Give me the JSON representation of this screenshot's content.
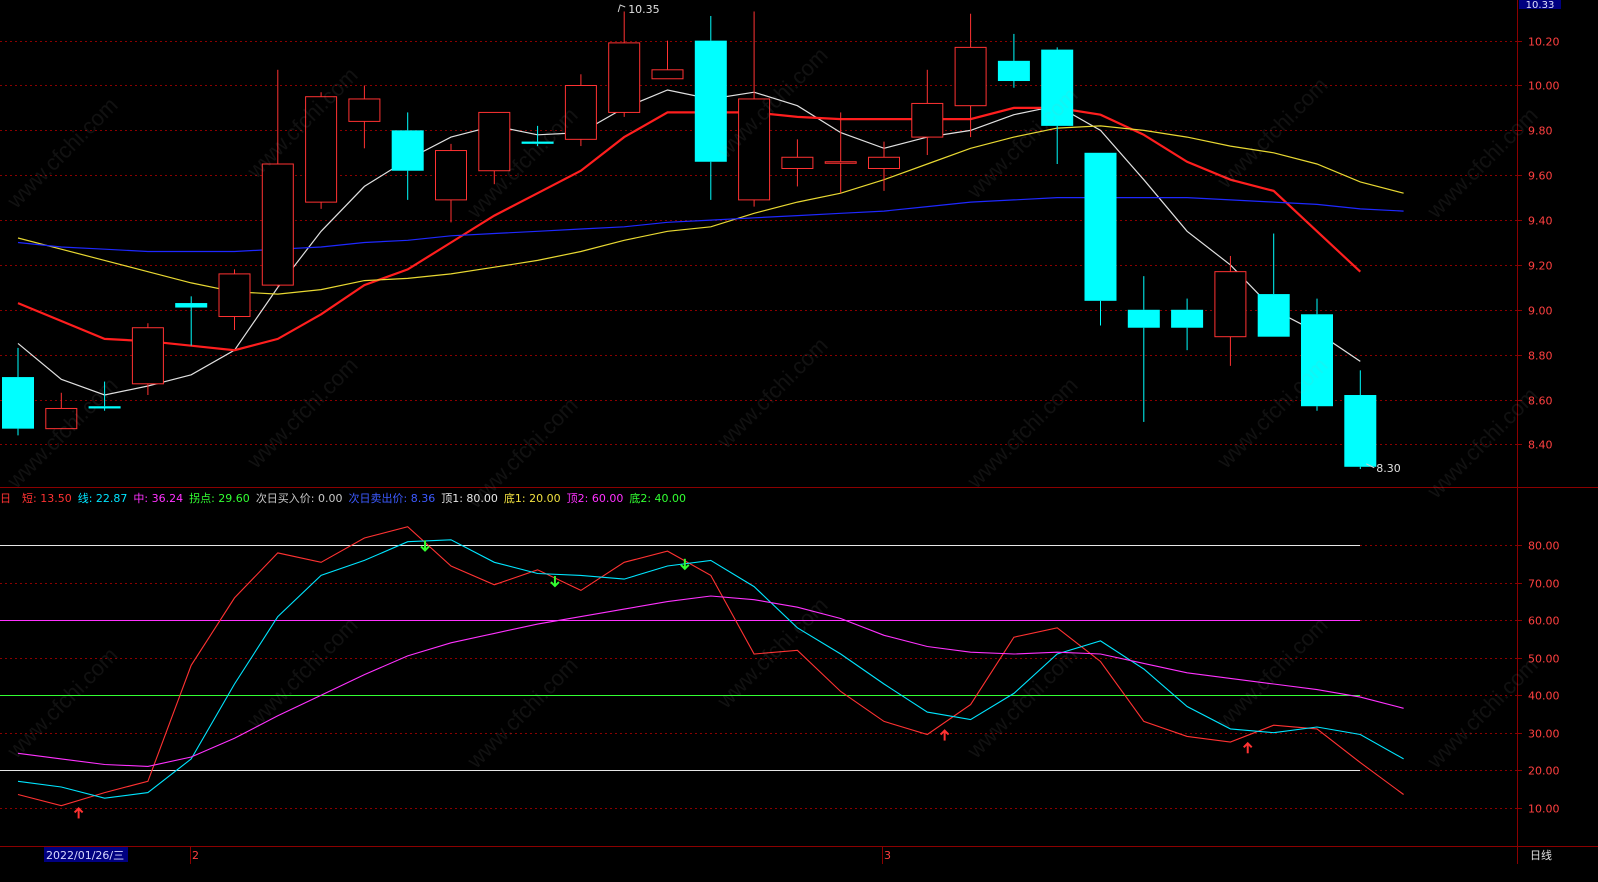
{
  "app": {
    "period_label": "日线",
    "date_label": "2022/01/26/三",
    "month_markers": [
      "2",
      "3"
    ],
    "top_right_price": "10.33",
    "watermark": "www.cfchi.com"
  },
  "colors": {
    "up": "#ff3232",
    "down": "#00ffff",
    "grid": "#8b0000",
    "axis_text": "#ff4040",
    "ma5": "#e0e0e0",
    "ma10": "#ff1e1e",
    "ma20": "#e8d832",
    "ma60": "#1e28ff"
  },
  "chart_data": [
    {
      "type": "candlestick",
      "ylim": [
        8.25,
        10.35
      ],
      "yticks": [
        8.4,
        8.6,
        8.8,
        9.0,
        9.2,
        9.4,
        9.6,
        9.8,
        10.0,
        10.2
      ],
      "annotations": [
        {
          "text": "10.35",
          "at_candle": 14,
          "price": 10.35
        },
        {
          "text": "8.30",
          "at_candle": 31,
          "price": 8.3
        }
      ],
      "candles": [
        {
          "o": 8.7,
          "h": 8.83,
          "l": 8.44,
          "c": 8.47
        },
        {
          "o": 8.47,
          "h": 8.63,
          "l": 8.47,
          "c": 8.56
        },
        {
          "o": 8.57,
          "h": 8.68,
          "l": 8.55,
          "c": 8.56
        },
        {
          "o": 8.67,
          "h": 8.94,
          "l": 8.62,
          "c": 8.92
        },
        {
          "o": 9.03,
          "h": 9.06,
          "l": 8.84,
          "c": 9.01
        },
        {
          "o": 8.97,
          "h": 9.18,
          "l": 8.91,
          "c": 9.16
        },
        {
          "o": 9.11,
          "h": 10.07,
          "l": 9.1,
          "c": 9.65
        },
        {
          "o": 9.48,
          "h": 9.97,
          "l": 9.45,
          "c": 9.95
        },
        {
          "o": 9.84,
          "h": 10.0,
          "l": 9.72,
          "c": 9.94
        },
        {
          "o": 9.8,
          "h": 9.88,
          "l": 9.49,
          "c": 9.62
        },
        {
          "o": 9.49,
          "h": 9.74,
          "l": 9.39,
          "c": 9.71
        },
        {
          "o": 9.62,
          "h": 9.88,
          "l": 9.56,
          "c": 9.88
        },
        {
          "o": 9.75,
          "h": 9.82,
          "l": 9.73,
          "c": 9.74
        },
        {
          "o": 9.76,
          "h": 10.05,
          "l": 9.73,
          "c": 10.0
        },
        {
          "o": 9.88,
          "h": 10.33,
          "l": 9.86,
          "c": 10.19
        },
        {
          "o": 10.03,
          "h": 10.2,
          "l": 10.03,
          "c": 10.07
        },
        {
          "o": 10.2,
          "h": 10.31,
          "l": 9.49,
          "c": 9.66
        },
        {
          "o": 9.49,
          "h": 10.33,
          "l": 9.46,
          "c": 9.94
        },
        {
          "o": 9.63,
          "h": 9.76,
          "l": 9.55,
          "c": 9.68
        },
        {
          "o": 9.66,
          "h": 9.88,
          "l": 9.52,
          "c": 9.66
        },
        {
          "o": 9.63,
          "h": 9.75,
          "l": 9.53,
          "c": 9.68
        },
        {
          "o": 9.77,
          "h": 10.07,
          "l": 9.69,
          "c": 9.92
        },
        {
          "o": 9.91,
          "h": 10.32,
          "l": 9.77,
          "c": 10.17
        },
        {
          "o": 10.11,
          "h": 10.23,
          "l": 9.99,
          "c": 10.02
        },
        {
          "o": 10.16,
          "h": 10.17,
          "l": 9.65,
          "c": 9.82
        },
        {
          "o": 9.7,
          "h": 9.7,
          "l": 8.93,
          "c": 9.04
        },
        {
          "o": 9.0,
          "h": 9.15,
          "l": 8.5,
          "c": 8.92
        },
        {
          "o": 9.0,
          "h": 9.05,
          "l": 8.82,
          "c": 8.92
        },
        {
          "o": 8.88,
          "h": 9.24,
          "l": 8.75,
          "c": 9.17
        },
        {
          "o": 9.07,
          "h": 9.34,
          "l": 8.88,
          "c": 8.88
        },
        {
          "o": 8.98,
          "h": 9.05,
          "l": 8.55,
          "c": 8.57
        },
        {
          "o": 8.62,
          "h": 8.73,
          "l": 8.29,
          "c": 8.3
        }
      ],
      "series": [
        {
          "name": "MA5",
          "color_key": "ma5",
          "width": 1.2,
          "values": [
            8.85,
            8.69,
            8.62,
            8.66,
            8.71,
            8.82,
            9.1,
            9.35,
            9.55,
            9.67,
            9.77,
            9.82,
            9.78,
            9.79,
            9.9,
            9.98,
            9.94,
            9.97,
            9.91,
            9.79,
            9.72,
            9.77,
            9.8,
            9.87,
            9.91,
            9.8,
            9.58,
            9.35,
            9.2,
            9.0,
            8.9,
            8.77
          ]
        },
        {
          "name": "MA10",
          "color_key": "ma10",
          "width": 2.2,
          "values": [
            9.03,
            8.95,
            8.87,
            8.86,
            8.84,
            8.82,
            8.87,
            8.98,
            9.11,
            9.18,
            9.3,
            9.42,
            9.52,
            9.62,
            9.77,
            9.88,
            9.88,
            9.88,
            9.86,
            9.85,
            9.85,
            9.85,
            9.85,
            9.9,
            9.9,
            9.87,
            9.78,
            9.66,
            9.58,
            9.53,
            9.35,
            9.17
          ]
        },
        {
          "name": "MA20",
          "color_key": "ma20",
          "width": 1.2,
          "values": [
            9.32,
            9.27,
            9.22,
            9.17,
            9.12,
            9.08,
            9.07,
            9.09,
            9.13,
            9.14,
            9.16,
            9.19,
            9.22,
            9.26,
            9.31,
            9.35,
            9.37,
            9.43,
            9.48,
            9.52,
            9.58,
            9.65,
            9.72,
            9.77,
            9.81,
            9.82,
            9.8,
            9.77,
            9.73,
            9.7,
            9.65,
            9.57,
            9.52
          ]
        },
        {
          "name": "MA60",
          "color_key": "ma60",
          "width": 1.2,
          "values": [
            9.3,
            9.28,
            9.27,
            9.26,
            9.26,
            9.26,
            9.27,
            9.28,
            9.3,
            9.31,
            9.33,
            9.34,
            9.35,
            9.36,
            9.37,
            9.39,
            9.4,
            9.41,
            9.42,
            9.43,
            9.44,
            9.46,
            9.48,
            9.49,
            9.5,
            9.5,
            9.5,
            9.5,
            9.49,
            9.48,
            9.47,
            9.45,
            9.44
          ]
        }
      ]
    },
    {
      "type": "line",
      "ylim": [
        0,
        90
      ],
      "yticks": [
        10,
        20,
        30,
        40,
        50,
        60,
        70,
        80
      ],
      "legend": [
        {
          "text": "短: 13.50",
          "color": "#ff3232"
        },
        {
          "text": "线: 22.87",
          "color": "#00e5ff"
        },
        {
          "text": "中: 36.24",
          "color": "#ff32ff"
        },
        {
          "text": "拐点: 29.60",
          "color": "#32ff32"
        },
        {
          "text": "次日买入价: 0.00",
          "color": "#c8c8c8"
        },
        {
          "text": "次日卖出价: 8.36",
          "color": "#3c5aff"
        },
        {
          "text": "顶1: 80.00",
          "color": "#e6e6e6"
        },
        {
          "text": "底1: 20.00",
          "color": "#f0e040"
        },
        {
          "text": "顶2: 60.00",
          "color": "#ff32ff"
        },
        {
          "text": "底2: 40.00",
          "color": "#32ff32"
        }
      ],
      "hlines": [
        {
          "value": 80,
          "color": "#e6e6e6"
        },
        {
          "value": 60,
          "color": "#ff32ff"
        },
        {
          "value": 40,
          "color": "#32ff32"
        },
        {
          "value": 20,
          "color": "#e6e6e6"
        }
      ],
      "series": [
        {
          "name": "短",
          "color": "#ff3232",
          "values": [
            13.5,
            10.5,
            14.0,
            17.0,
            48.0,
            66.0,
            78.0,
            75.5,
            82.0,
            85.0,
            74.5,
            69.5,
            73.5,
            68.0,
            75.5,
            78.5,
            72.0,
            51.0,
            52.0,
            41.0,
            33.0,
            29.5,
            37.5,
            55.5,
            58.0,
            49.0,
            33.0,
            29.0,
            27.5,
            32.0,
            31.0,
            22.0,
            13.5
          ]
        },
        {
          "name": "线",
          "color": "#00e5ff",
          "values": [
            17.0,
            15.5,
            12.5,
            14.0,
            23.0,
            43.0,
            61.0,
            72.0,
            76.0,
            81.0,
            81.5,
            75.5,
            72.5,
            72.0,
            71.0,
            74.5,
            76.0,
            69.0,
            58.0,
            51.0,
            43.0,
            35.5,
            33.5,
            40.5,
            51.0,
            54.5,
            47.0,
            37.0,
            31.0,
            30.0,
            31.5,
            29.5,
            23.0
          ]
        },
        {
          "name": "中",
          "color": "#ff32ff",
          "values": [
            24.5,
            23.0,
            21.5,
            21.0,
            23.5,
            28.5,
            34.5,
            40.0,
            45.5,
            50.5,
            54.0,
            56.5,
            59.0,
            61.0,
            63.0,
            65.0,
            66.5,
            65.5,
            63.5,
            60.5,
            56.0,
            53.0,
            51.5,
            51.0,
            51.5,
            51.0,
            48.5,
            46.0,
            44.5,
            43.0,
            41.5,
            39.5,
            36.5
          ]
        }
      ],
      "signals": [
        {
          "type": "buy",
          "index": 1.4
        },
        {
          "type": "sell",
          "index": 9.4
        },
        {
          "type": "sell",
          "index": 12.4
        },
        {
          "type": "sell",
          "index": 15.4
        },
        {
          "type": "buy",
          "index": 21.4
        },
        {
          "type": "buy",
          "index": 28.4
        }
      ]
    }
  ]
}
